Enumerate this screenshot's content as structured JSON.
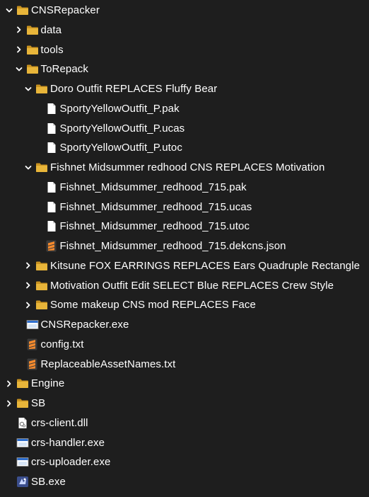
{
  "tree": [
    {
      "label": "CNSRepacker",
      "type": "folder",
      "expanded": true,
      "depth": 0
    },
    {
      "label": "data",
      "type": "folder",
      "expanded": false,
      "depth": 1
    },
    {
      "label": "tools",
      "type": "folder",
      "expanded": false,
      "depth": 1
    },
    {
      "label": "ToRepack",
      "type": "folder",
      "expanded": true,
      "depth": 1
    },
    {
      "label": "Doro Outfit REPLACES Fluffy Bear",
      "type": "folder",
      "expanded": true,
      "depth": 2
    },
    {
      "label": "SportyYellowOutfit_P.pak",
      "type": "file",
      "depth": 3
    },
    {
      "label": "SportyYellowOutfit_P.ucas",
      "type": "file",
      "depth": 3
    },
    {
      "label": "SportyYellowOutfit_P.utoc",
      "type": "file",
      "depth": 3
    },
    {
      "label": "Fishnet Midsummer redhood CNS REPLACES Motivation",
      "type": "folder",
      "expanded": true,
      "depth": 2
    },
    {
      "label": "Fishnet_Midsummer_redhood_715.pak",
      "type": "file",
      "depth": 3
    },
    {
      "label": "Fishnet_Midsummer_redhood_715.ucas",
      "type": "file",
      "depth": 3
    },
    {
      "label": "Fishnet_Midsummer_redhood_715.utoc",
      "type": "file",
      "depth": 3
    },
    {
      "label": "Fishnet_Midsummer_redhood_715.dekcns.json",
      "type": "sublime",
      "depth": 3
    },
    {
      "label": "Kitsune FOX EARRINGS REPLACES Ears Quadruple Rectangle",
      "type": "folder",
      "expanded": false,
      "depth": 2
    },
    {
      "label": "Motivation Outfit Edit SELECT Blue REPLACES Crew Style",
      "type": "folder",
      "expanded": false,
      "depth": 2
    },
    {
      "label": "Some makeup CNS mod REPLACES Face",
      "type": "folder",
      "expanded": false,
      "depth": 2
    },
    {
      "label": "CNSRepacker.exe",
      "type": "exe",
      "depth": 1
    },
    {
      "label": "config.txt",
      "type": "sublime",
      "depth": 1
    },
    {
      "label": "ReplaceableAssetNames.txt",
      "type": "sublime",
      "depth": 1
    },
    {
      "label": "Engine",
      "type": "folder",
      "expanded": false,
      "depth": 0
    },
    {
      "label": "SB",
      "type": "folder",
      "expanded": false,
      "depth": 0
    },
    {
      "label": "crs-client.dll",
      "type": "dll",
      "depth": 0
    },
    {
      "label": "crs-handler.exe",
      "type": "exe",
      "depth": 0
    },
    {
      "label": "crs-uploader.exe",
      "type": "exe",
      "depth": 0
    },
    {
      "label": "SB.exe",
      "type": "sbexe",
      "depth": 0
    }
  ],
  "colors": {
    "background": "#1e1e1e",
    "text": "#ffffff",
    "folder": "#e8b53a",
    "folder_dark": "#c99320",
    "sublime": "#f58a2d"
  }
}
